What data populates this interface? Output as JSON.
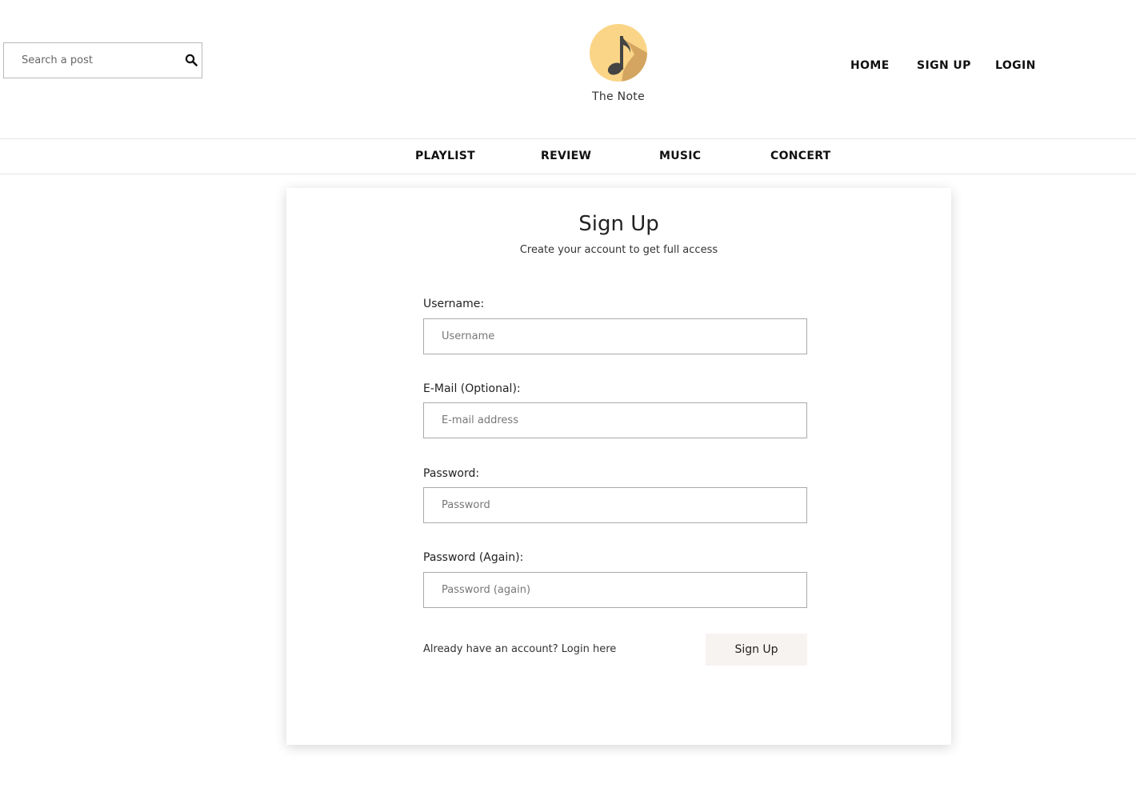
{
  "header": {
    "search": {
      "placeholder": "Search a post",
      "icon": "search-icon"
    },
    "logo": {
      "icon": "music-note-icon",
      "circle_color": "#fbd587",
      "shadow_color": "#d4a560",
      "note_color": "#444444"
    },
    "brand_name": "The Note",
    "nav": [
      {
        "label": "HOME"
      },
      {
        "label": "SIGN UP"
      },
      {
        "label": "LOGIN"
      }
    ]
  },
  "sub_nav": [
    {
      "label": "PLAYLIST"
    },
    {
      "label": "REVIEW"
    },
    {
      "label": "MUSIC"
    },
    {
      "label": "CONCERT"
    }
  ],
  "form": {
    "title": "Sign Up",
    "subtitle": "Create your account to get full access",
    "fields": [
      {
        "label": "Username:",
        "placeholder": "Username",
        "value": ""
      },
      {
        "label": "E-Mail (Optional):",
        "placeholder": "E-mail address",
        "value": ""
      },
      {
        "label": "Password:",
        "placeholder": "Password",
        "value": ""
      },
      {
        "label": "Password (Again):",
        "placeholder": "Password (again)",
        "value": ""
      }
    ],
    "login_prompt": "Already have an account? Login here",
    "submit_label": "Sign Up",
    "submit_bg": "#f7f3f1"
  }
}
